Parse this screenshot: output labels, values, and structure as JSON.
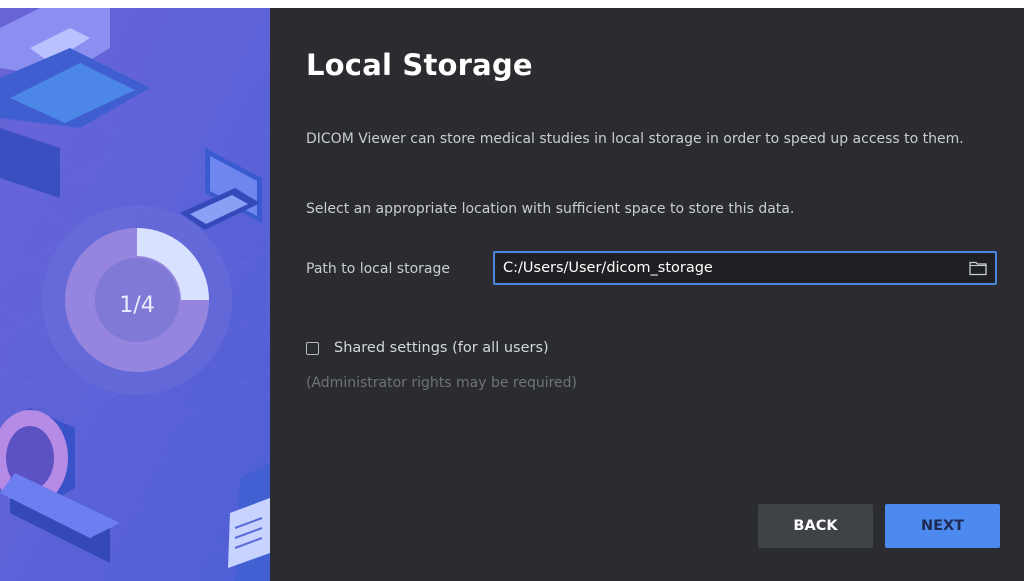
{
  "wizard": {
    "step_indicator": "1/4",
    "step_progress": 0.25,
    "title": "Local Storage",
    "description": "DICOM Viewer can store medical studies in local storage in order to speed up access to them.",
    "instruction": "Select an appropriate location with sufficient space to store this data.",
    "path_label": "Path to local storage",
    "path_value": "C:/Users/User/dicom_storage",
    "browse_icon": "folder-icon",
    "shared_label": "Shared settings (for all users)",
    "shared_checked": false,
    "admin_note": "(Administrator rights may be required)",
    "back_label": "BACK",
    "next_label": "NEXT"
  },
  "colors": {
    "illustration_bg": "#5a5fd6",
    "panel_bg": "#2b2c2f",
    "accent": "#4d8af0",
    "field_border": "#4d86e0"
  }
}
